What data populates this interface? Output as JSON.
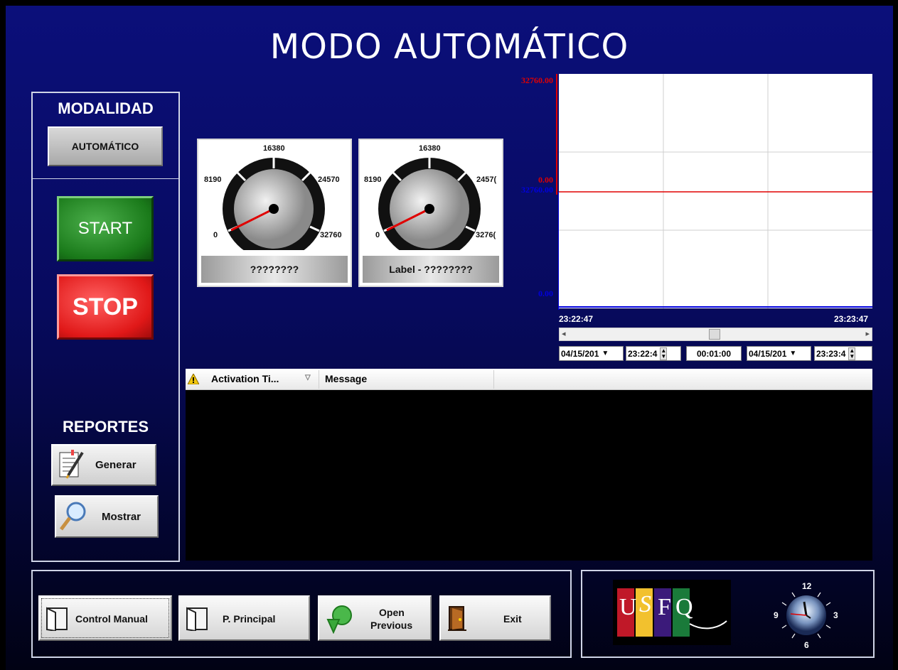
{
  "title": "MODO AUTOMÁTICO",
  "modalidad": {
    "header": "MODALIDAD",
    "mode_button": "AUTOMÁTICO"
  },
  "controls": {
    "start": "START",
    "stop": "STOP"
  },
  "reportes": {
    "header": "REPORTES",
    "generar": "Generar",
    "mostrar": "Mostrar"
  },
  "gauges": [
    {
      "ticks": [
        "16380",
        "8190",
        "24570",
        "0",
        "32760"
      ],
      "label": "????????",
      "value": 0
    },
    {
      "ticks": [
        "16380",
        "8190",
        "2457(",
        "0",
        "3276("
      ],
      "label": "Label - ????????",
      "value": 0
    }
  ],
  "trend": {
    "red_axis": {
      "max": "32760.00",
      "min": "0.00",
      "color": "#e00000"
    },
    "blue_axis": {
      "max": "32760.00",
      "min": "0.00",
      "color": "#0000dd"
    },
    "time_start": "23:22:47",
    "time_end": "23:23:47",
    "start_date": "04/15/201",
    "start_time": "23:22:4",
    "duration": "00:01:00",
    "end_date": "04/15/201",
    "end_time": "23:23:4",
    "red_level": 0
  },
  "alarms": {
    "col_activation": "Activation Ti...",
    "col_message": "Message",
    "rows": []
  },
  "nav": {
    "control_manual": "Control Manual",
    "principal": "P. Principal",
    "open_previous_1": "Open",
    "open_previous_2": "Previous",
    "exit": "Exit"
  },
  "logo": {
    "letters": [
      "U",
      "S",
      "F",
      "Q"
    ]
  },
  "clock": {
    "n12": "12",
    "n3": "3",
    "n6": "6",
    "n9": "9"
  }
}
